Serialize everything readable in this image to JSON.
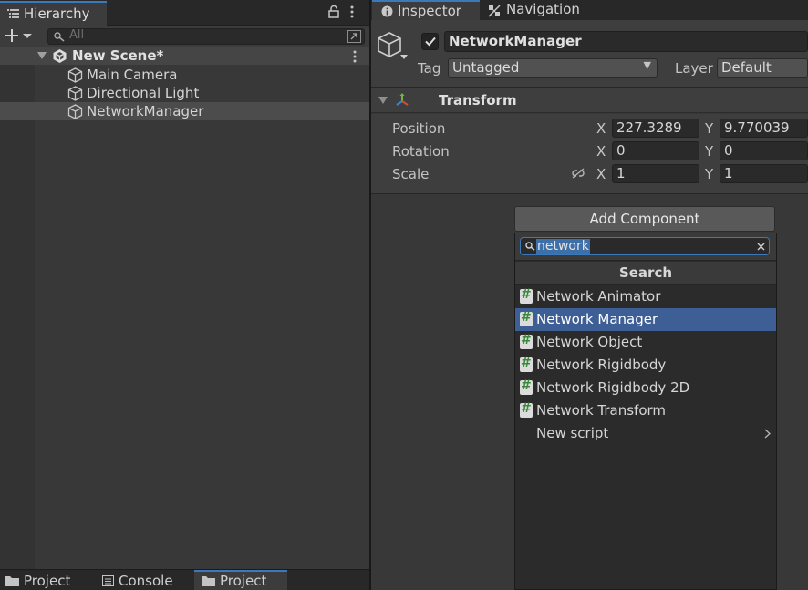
{
  "hierarchy": {
    "tab_label": "Hierarchy",
    "search_placeholder": "All",
    "scene_name": "New Scene*",
    "items": [
      {
        "label": "Main Camera"
      },
      {
        "label": "Directional Light"
      },
      {
        "label": "NetworkManager"
      }
    ]
  },
  "bottom_tabs": [
    {
      "label": "Project"
    },
    {
      "label": "Console"
    },
    {
      "label": "Project"
    }
  ],
  "inspector": {
    "tabs": [
      {
        "label": "Inspector"
      },
      {
        "label": "Navigation"
      }
    ],
    "object_name": "NetworkManager",
    "active_checked": true,
    "tag_label": "Tag",
    "tag_value": "Untagged",
    "layer_label": "Layer",
    "layer_value": "Default",
    "transform": {
      "title": "Transform",
      "position_label": "Position",
      "rotation_label": "Rotation",
      "scale_label": "Scale",
      "x_axis": "X",
      "y_axis": "Y",
      "position": {
        "x": "227.3289",
        "y": "9.770039"
      },
      "rotation": {
        "x": "0",
        "y": "0"
      },
      "scale": {
        "x": "1",
        "y": "1"
      }
    },
    "add_component_label": "Add Component"
  },
  "add_component_popup": {
    "search_text": "network",
    "title": "Search",
    "items": [
      {
        "label": "Network Animator",
        "icon": "script-icon"
      },
      {
        "label": "Network Manager",
        "icon": "script-icon",
        "selected": true
      },
      {
        "label": "Network Object",
        "icon": "script-icon"
      },
      {
        "label": "Network Rigidbody",
        "icon": "script-icon"
      },
      {
        "label": "Network Rigidbody 2D",
        "icon": "script-icon"
      },
      {
        "label": "Network Transform",
        "icon": "script-icon"
      }
    ],
    "new_script_label": "New script"
  },
  "colors": {
    "accent": "#3a79bb",
    "selection": "#3e5f96",
    "panel_bg": "#383838",
    "tab_bar_bg": "#282828"
  }
}
